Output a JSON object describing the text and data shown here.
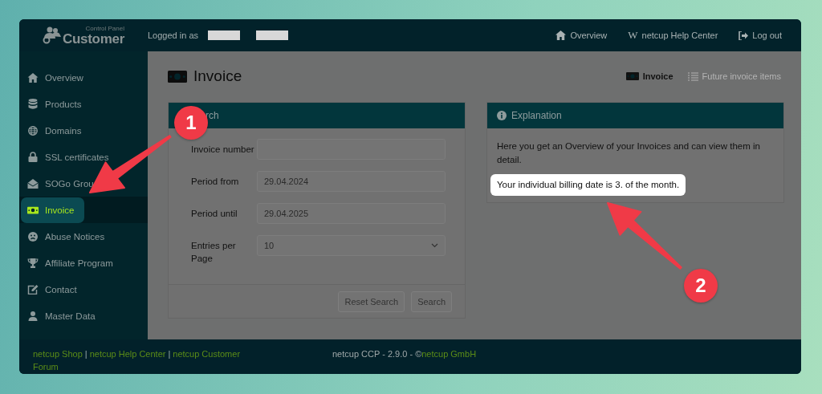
{
  "header": {
    "logo_caption": "Control Panel",
    "logo_title": "Customer",
    "logged_in_label": "Logged in as",
    "links": [
      {
        "label": "Overview"
      },
      {
        "label": "netcup Help Center",
        "glyph": "W"
      },
      {
        "label": "Log out"
      }
    ]
  },
  "sidebar": {
    "items": [
      {
        "label": "Overview",
        "selected": false
      },
      {
        "label": "Products",
        "selected": false
      },
      {
        "label": "Domains",
        "selected": false
      },
      {
        "label": "SSL certificates",
        "selected": false
      },
      {
        "label": "SOGo Grou",
        "selected": false
      },
      {
        "label": "Invoice",
        "selected": true
      },
      {
        "label": "Abuse Notices",
        "selected": false
      },
      {
        "label": "Affiliate Program",
        "selected": false
      },
      {
        "label": "Contact",
        "selected": false
      },
      {
        "label": "Master Data",
        "selected": false
      }
    ]
  },
  "page": {
    "title": "Invoice",
    "tabs": [
      {
        "label": "Invoice",
        "selected": true
      },
      {
        "label": "Future invoice items",
        "selected": false
      }
    ]
  },
  "search_card": {
    "title": "rch",
    "fields": [
      {
        "label": "Invoice number",
        "kind": "text"
      },
      {
        "label": "Period from",
        "kind": "text",
        "value": "29.04.2024"
      },
      {
        "label": "Period until",
        "kind": "text",
        "value": "29.04.2025"
      },
      {
        "label": "Entries per Page",
        "kind": "select",
        "value": "10"
      }
    ],
    "buttons": [
      "Reset Search",
      "Search"
    ]
  },
  "explanation_card": {
    "title": "Explanation",
    "text": "Here you get an Overview of your Invoices and can view them in detail.",
    "highlight": "Your individual billing date is 3. of the month."
  },
  "footer": {
    "links": [
      "netcup Shop",
      "netcup Help Center",
      "netcup Customer Forum"
    ],
    "separator": "|",
    "version": "netcup CCP - 2.9.0 - ©",
    "company": "netcup GmbH"
  },
  "annotations": [
    {
      "label": "1"
    },
    {
      "label": "2"
    }
  ]
}
